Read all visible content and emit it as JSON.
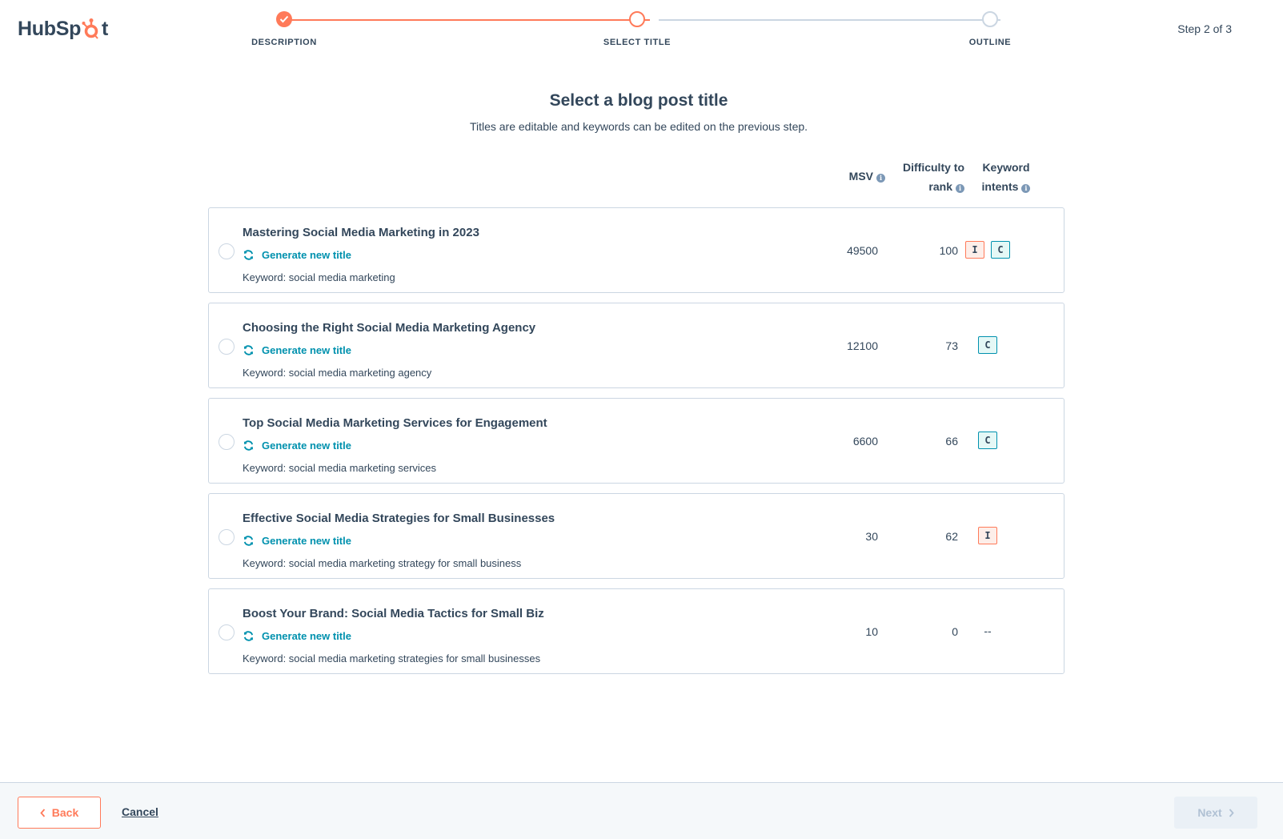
{
  "brand": {
    "logo_left": "HubSp",
    "logo_right": "t",
    "accent": "#ff7a59",
    "link": "#0091ae"
  },
  "stepper": {
    "steps": [
      {
        "label": "DESCRIPTION",
        "state": "complete"
      },
      {
        "label": "SELECT TITLE",
        "state": "current"
      },
      {
        "label": "OUTLINE",
        "state": "pending"
      }
    ],
    "counter": "Step 2 of 3"
  },
  "heading": {
    "title": "Select a blog post title",
    "subtitle": "Titles are editable and keywords can be edited on the previous step."
  },
  "columns": {
    "msv": "MSV",
    "difficulty_line1": "Difficulty to",
    "difficulty_line2": "rank",
    "intents_line1": "Keyword",
    "intents_line2": "intents",
    "info_glyph": "i"
  },
  "generate_label": "Generate new title",
  "rows": [
    {
      "title": "Mastering Social Media Marketing in 2023",
      "keyword": "Keyword: social media marketing",
      "msv": "49500",
      "difficulty": "100",
      "intents": [
        "I",
        "C"
      ]
    },
    {
      "title": "Choosing the Right Social Media Marketing Agency",
      "keyword": "Keyword: social media marketing agency",
      "msv": "12100",
      "difficulty": "73",
      "intents": [
        "C"
      ]
    },
    {
      "title": "Top Social Media Marketing Services for Engagement",
      "keyword": "Keyword: social media marketing services",
      "msv": "6600",
      "difficulty": "66",
      "intents": [
        "C"
      ]
    },
    {
      "title": "Effective Social Media Strategies for Small Businesses",
      "keyword": "Keyword: social media marketing strategy for small business",
      "msv": "30",
      "difficulty": "62",
      "intents": [
        "I"
      ]
    },
    {
      "title": "Boost Your Brand: Social Media Tactics for Small Biz",
      "keyword": "Keyword: social media marketing strategies for small businesses",
      "msv": "10",
      "difficulty": "0",
      "intents": [],
      "intents_empty": "--"
    }
  ],
  "footer": {
    "back": "Back",
    "cancel": "Cancel",
    "next": "Next"
  }
}
